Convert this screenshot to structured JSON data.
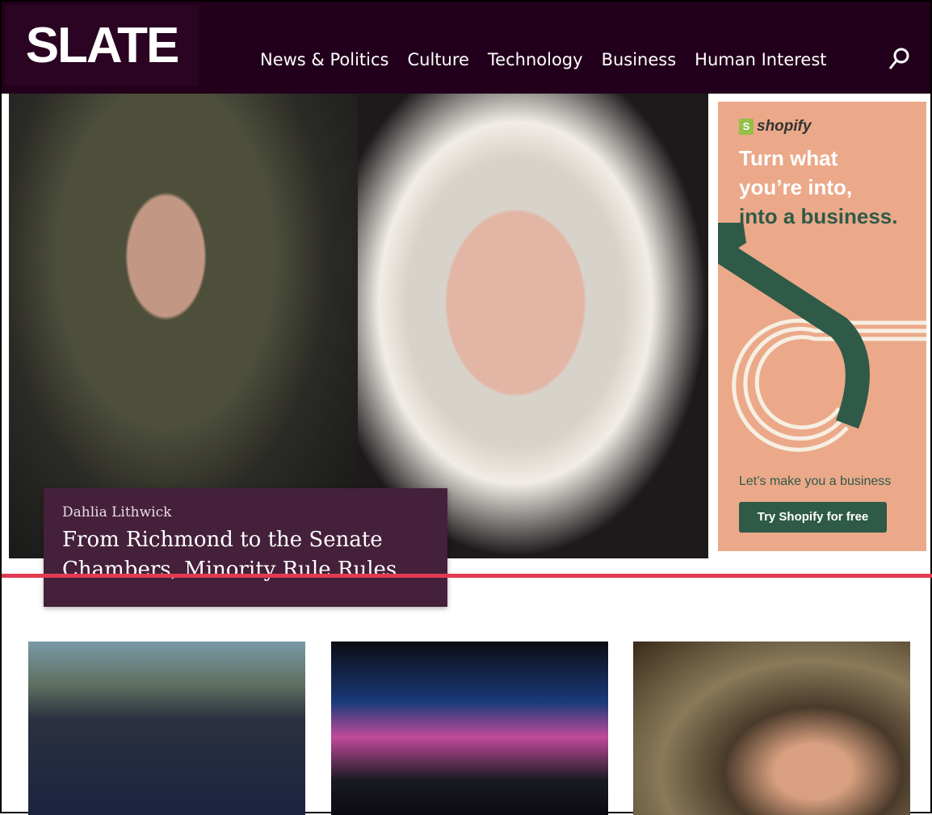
{
  "header": {
    "logo": "SLATE",
    "nav": [
      "News & Politics",
      "Culture",
      "Technology",
      "Business",
      "Human Interest"
    ]
  },
  "hero": {
    "author": "Dahlia Lithwick",
    "title": "From Richmond to the Senate Chambers, Minority Rule Rules"
  },
  "ad": {
    "brand": "shopify",
    "headline_1": "Turn what",
    "headline_2": "you’re into,",
    "headline_3": "into a business.",
    "sub": "Let’s make you a business",
    "cta": "Try Shopify for free",
    "colors": {
      "bg": "#eba98a",
      "green": "#2f5a48"
    }
  },
  "accent": "#e23b51"
}
